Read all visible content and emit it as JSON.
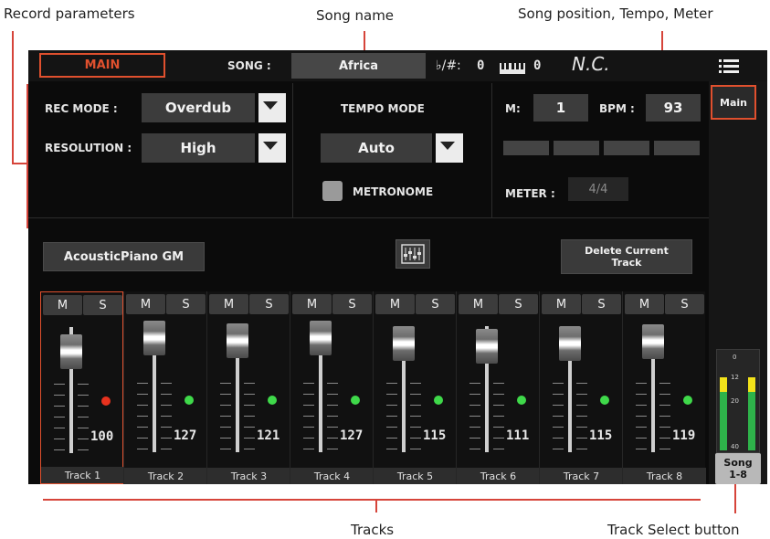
{
  "callouts": {
    "record_parameters": "Record parameters",
    "song_name": "Song name",
    "song_position": "Song position, Tempo, Meter",
    "tracks": "Tracks",
    "track_select": "Track Select button"
  },
  "header": {
    "main_tab": "MAIN",
    "song_label": "SONG :",
    "song_name": "Africa",
    "transpose_symbol": "♭/#:",
    "transpose_value": "0",
    "keyboard_value": "0",
    "chord": "N.C."
  },
  "rec": {
    "mode_label": "REC MODE :",
    "mode_value": "Overdub",
    "resolution_label": "RESOLUTION :",
    "resolution_value": "High"
  },
  "tempo": {
    "mode_label": "TEMPO MODE",
    "mode_value": "Auto",
    "metronome_label": "METRONOME"
  },
  "position": {
    "measure_label": "M:",
    "measure_value": "1",
    "bpm_label": "BPM :",
    "bpm_value": "93",
    "meter_label": "METER :",
    "meter_value": "4/4",
    "beats": 4
  },
  "sound": {
    "name": "AcousticPiano GM"
  },
  "delete_track": {
    "label_line1": "Delete Current",
    "label_line2": "Track"
  },
  "side": {
    "main_label": "Main",
    "song_select_line1": "Song",
    "song_select_line2": "1-8",
    "meter_scale": [
      "0",
      "12",
      "20",
      "40"
    ]
  },
  "tracks": [
    {
      "name": "Track 1",
      "value": "100",
      "level": 0.79,
      "led": "red",
      "selected": true
    },
    {
      "name": "Track 2",
      "value": "127",
      "level": 1.0,
      "led": "green",
      "selected": false
    },
    {
      "name": "Track 3",
      "value": "121",
      "level": 0.95,
      "led": "green",
      "selected": false
    },
    {
      "name": "Track 4",
      "value": "127",
      "level": 1.0,
      "led": "green",
      "selected": false
    },
    {
      "name": "Track 5",
      "value": "115",
      "level": 0.91,
      "led": "green",
      "selected": false
    },
    {
      "name": "Track 6",
      "value": "111",
      "level": 0.87,
      "led": "green",
      "selected": false
    },
    {
      "name": "Track 7",
      "value": "115",
      "level": 0.91,
      "led": "green",
      "selected": false
    },
    {
      "name": "Track 8",
      "value": "119",
      "level": 0.94,
      "led": "green",
      "selected": false
    }
  ],
  "mute_label": "M",
  "solo_label": "S",
  "colors": {
    "accent": "#e0502e",
    "led_green": "#3fd94a",
    "led_red": "#e8321e",
    "callout_line": "#d6443a"
  }
}
